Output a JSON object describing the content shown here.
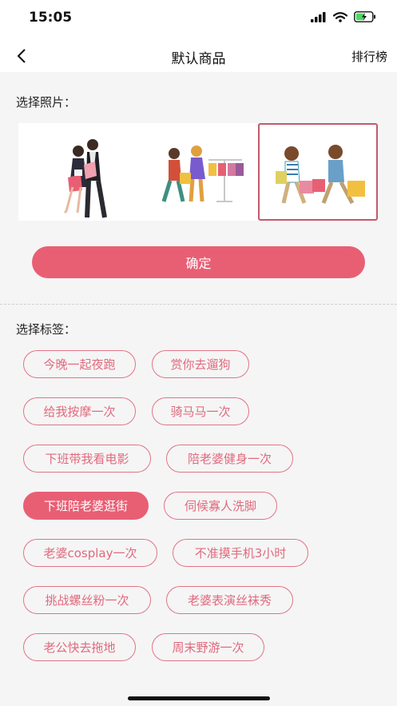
{
  "status_bar": {
    "time": "15:05"
  },
  "nav": {
    "title": "默认商品",
    "right_label": "排行榜"
  },
  "photo_section": {
    "label": "选择照片：",
    "photos": [
      "couple-shopping-illustration",
      "clothes-shopping-illustration",
      "couple-running-with-bags-illustration"
    ],
    "selected_index": 2
  },
  "confirm_label": "确定",
  "tag_section": {
    "label": "选择标签：",
    "tags": [
      "今晚一起夜跑",
      "赏你去遛狗",
      "给我按摩一次",
      "骑马马一次",
      "下班带我看电影",
      "陪老婆健身一次",
      "下班陪老婆逛街",
      "伺候寡人洗脚",
      "老婆cosplay一次",
      "不准摸手机3小时",
      "挑战螺丝粉一次",
      "老婆表演丝袜秀",
      "老公快去拖地",
      "周末野游一次"
    ],
    "selected_tag": "下班陪老婆逛街"
  },
  "colors": {
    "accent": "#e85f74",
    "tag_border": "#e07485",
    "selected_border": "#c25a6a"
  }
}
